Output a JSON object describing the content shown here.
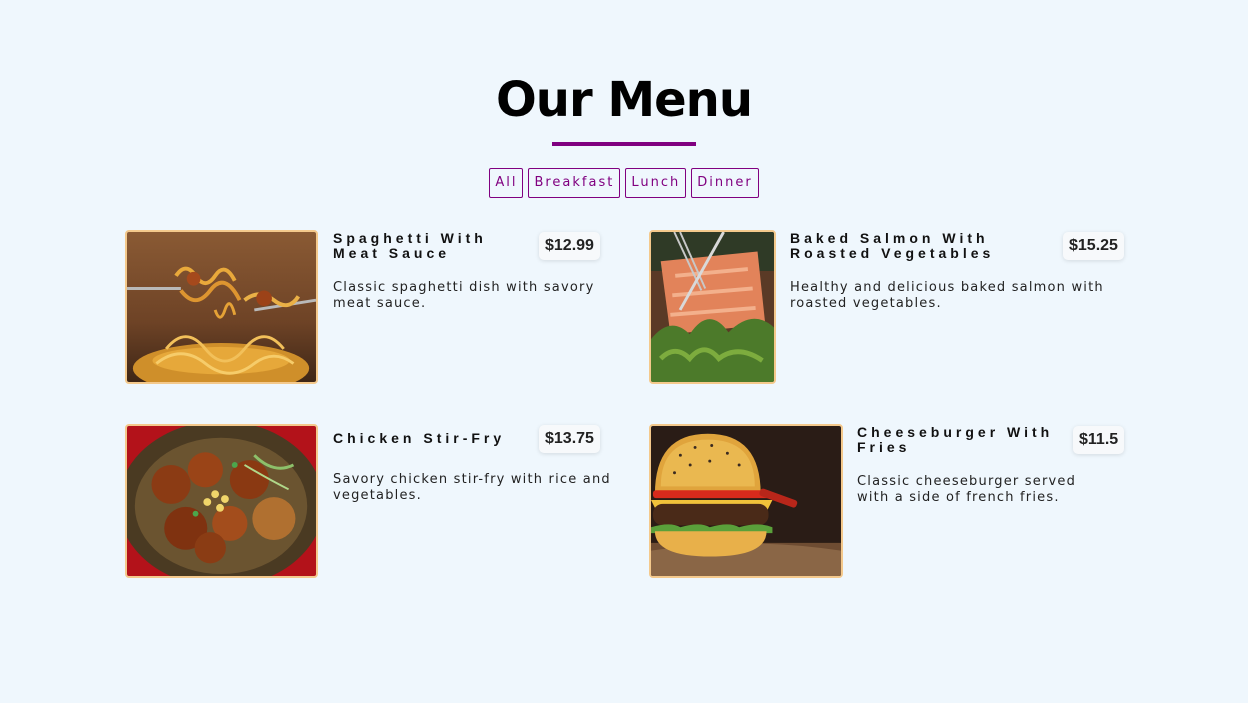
{
  "page": {
    "title": "Our Menu",
    "accent_color": "#800080",
    "background_color": "#eff7fd"
  },
  "filters": [
    {
      "label": "All"
    },
    {
      "label": "Breakfast"
    },
    {
      "label": "Lunch"
    },
    {
      "label": "Dinner"
    }
  ],
  "menu": [
    {
      "name": "Spaghetti With Meat Sauce",
      "price": "$12.99",
      "description": "Classic spaghetti dish with savory meat sauce."
    },
    {
      "name": "Baked Salmon With Roasted Vegetables",
      "price": "$15.25",
      "description": "Healthy and delicious baked salmon with roasted vegetables."
    },
    {
      "name": "Chicken Stir-Fry",
      "price": "$13.75",
      "description": "Savory chicken stir-fry with rice and vegetables."
    },
    {
      "name": "Cheeseburger With Fries",
      "price": "$11.5",
      "description": "Classic cheeseburger served with a side of french fries."
    }
  ]
}
